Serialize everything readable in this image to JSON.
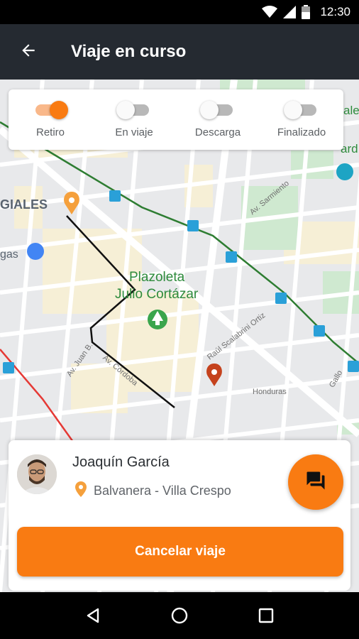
{
  "status_bar": {
    "time": "12:30",
    "icons": [
      "wifi-icon",
      "signal-icon",
      "battery-icon"
    ]
  },
  "app_bar": {
    "title": "Viaje en curso",
    "back_icon": "arrow-back-icon"
  },
  "steps": [
    {
      "label": "Retiro",
      "on": true
    },
    {
      "label": "En viaje",
      "on": false
    },
    {
      "label": "Descarga",
      "on": false
    },
    {
      "label": "Finalizado",
      "on": false
    }
  ],
  "map": {
    "labels": {
      "neighborhood": "GIALES",
      "plaza_line1": "Plazoleta",
      "plaza_line2": "Julio Cortázar",
      "left_partial": "gas",
      "right_partial_top": "ale",
      "right_partial_2": "ard",
      "street_sarmiento": "Av. Sarmiento",
      "street_scalabrini": "Raúl Scalabrini Ortiz",
      "street_juan_b": "Av. Juan B.",
      "street_honduras": "Honduras",
      "street_gallo": "Gallo",
      "street_cordoba": "Av. Córdoba"
    },
    "colors": {
      "pickup_pin": "#f5a03c",
      "dropoff_pin": "#c5421d",
      "route": "#111111",
      "subway_line": "#2e7d32",
      "park": "#c8e6c9"
    }
  },
  "driver": {
    "name": "Joaquín García",
    "route": "Balvanera - Villa Crespo",
    "chat_icon": "chat-icon",
    "location_icon": "location-pin-icon"
  },
  "actions": {
    "cancel_label": "Cancelar viaje"
  },
  "colors": {
    "accent": "#f97b12",
    "app_bar": "#252a31"
  }
}
